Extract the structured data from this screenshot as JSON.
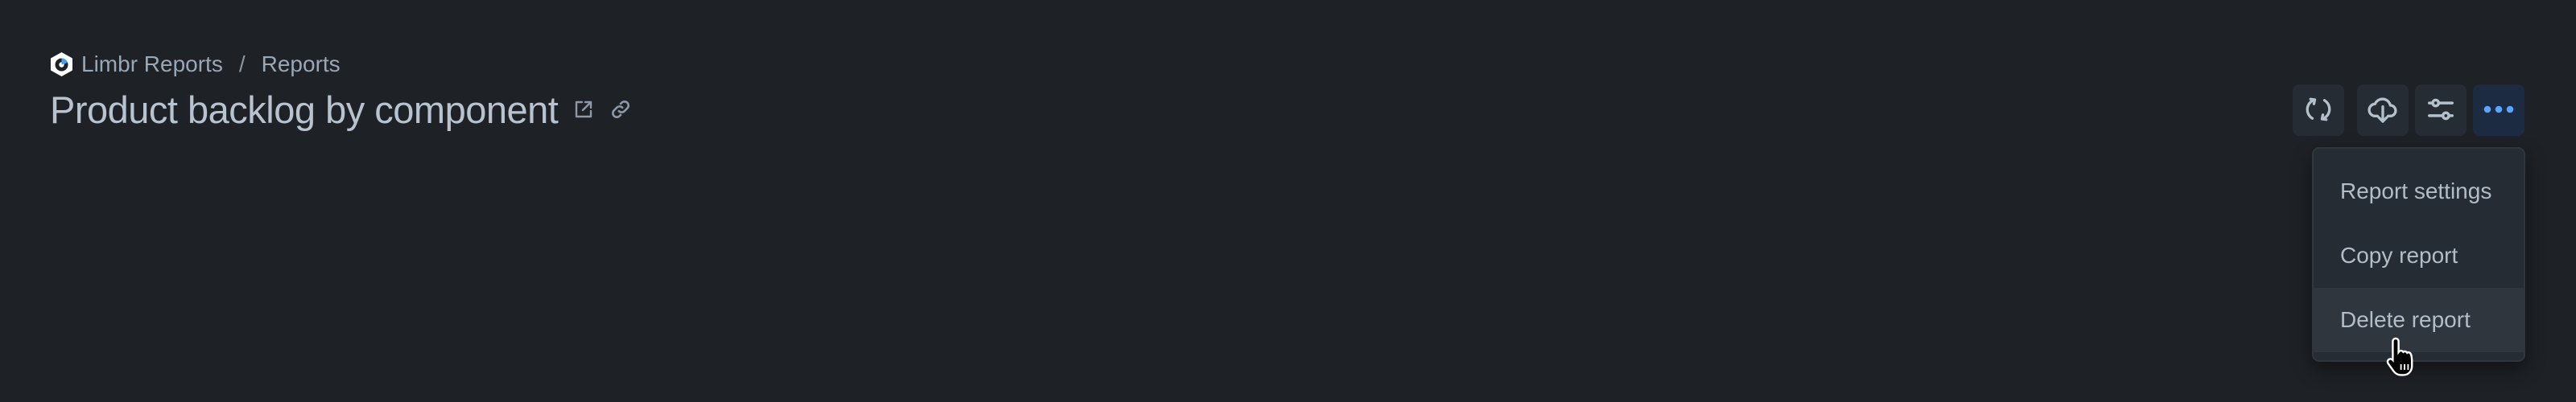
{
  "breadcrumb": {
    "logo_icon": "limbr-logo-icon",
    "items": [
      {
        "label": "Limbr Reports"
      },
      {
        "label": "Reports"
      }
    ],
    "separator": "/"
  },
  "header": {
    "title": "Product backlog by component",
    "icons": [
      "external-link-icon",
      "link-icon"
    ]
  },
  "toolbar": {
    "buttons": [
      {
        "name": "refresh",
        "icon": "refresh-icon"
      },
      {
        "name": "download",
        "icon": "cloud-download-icon"
      },
      {
        "name": "filters",
        "icon": "sliders-icon"
      },
      {
        "name": "more",
        "icon": "more-horizontal-icon",
        "active": true
      }
    ]
  },
  "menu": {
    "items": [
      {
        "label": "Report settings"
      },
      {
        "label": "Copy report"
      },
      {
        "label": "Delete report",
        "hovered": true
      }
    ]
  },
  "colors": {
    "background": "#1e2126",
    "button_bg": "#262c33",
    "active_button_bg": "#1c2a42",
    "accent": "#58a6ff",
    "text_primary": "#b8c3cf",
    "text_secondary": "#9aa7b4",
    "menu_hover": "#30363d"
  }
}
